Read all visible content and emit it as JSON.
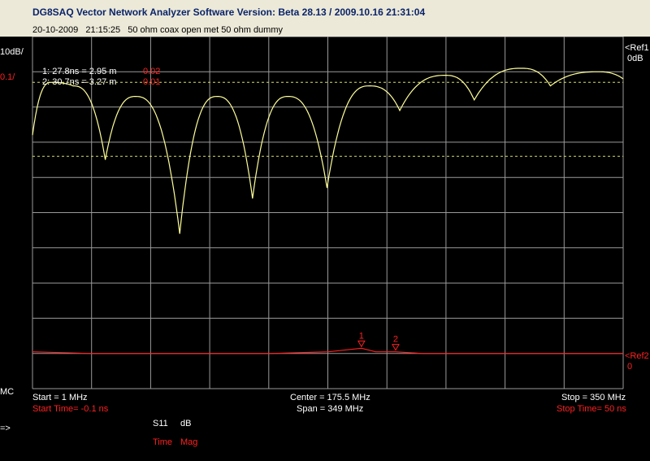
{
  "window": {
    "title": "DG8SAQ Vector Network Analyzer Software    Version:  Beta 28.13 / 2009.10.16 21:31:04"
  },
  "info": {
    "date": "20-10-2009",
    "time": "21:15:25",
    "description": "50 ohm coax open met 50 ohm dummy"
  },
  "scale": {
    "left_top": "10dB/",
    "left_second": "0.1/",
    "ref1_label": "<Ref1",
    "ref1_value": "0dB",
    "ref2_label": "<Ref2",
    "ref2_value": "0",
    "mc_label": "MC",
    "arrow_label": "=>"
  },
  "markers": {
    "line1": "1:   27.8ns = 2.95 m",
    "line1_value": "0.02",
    "line2": "2:   30.7ns = 3.27 m",
    "line2_value": "0.01",
    "m1_tag": "1",
    "m2_tag": "2"
  },
  "footer": {
    "start": "Start = 1 MHz",
    "start_time": "Start Time= -0.1 ns",
    "center": "Center = 175.5 MHz",
    "span": "Span = 349 MHz",
    "stop": "Stop = 350 MHz",
    "stop_time": "Stop Time= 50 ns",
    "s11": "S11",
    "db": "dB",
    "time": "Time",
    "mag": "Mag"
  },
  "colors": {
    "background": "#000000",
    "grid": "#9a9a9a",
    "trace1": "#ffff99",
    "limit_lines": "#d8e060",
    "trace2": "#ff2020",
    "label_white": "#ffffff",
    "label_red": "#ff2020"
  },
  "chart_data": [
    {
      "type": "line",
      "trace": "S11 dB (frequency)",
      "x_unit": "MHz",
      "x_range": [
        1,
        350
      ],
      "y_unit": "dB",
      "y_scale_per_div": 10,
      "ref": 0,
      "grid": true,
      "description_of_shape": "periodic ripple (standing wave) with deep nulls at about 44, 88, 131, 175 MHz, and shallower nulls with rising peaks toward 350 MHz",
      "x": [
        1,
        12,
        25,
        44,
        62,
        88,
        110,
        131,
        152,
        175,
        200,
        218,
        245,
        262,
        290,
        307,
        335,
        350
      ],
      "y": [
        -28,
        -13,
        -14,
        -35,
        -17,
        -56,
        -17,
        -46,
        -17,
        -43,
        -14,
        -21,
        -11,
        -18,
        -9,
        -14,
        -10,
        -12
      ],
      "limit_lines_dB": [
        -13,
        -34
      ]
    },
    {
      "type": "line",
      "trace": "S11 Mag (time)",
      "x_unit": "ns",
      "x_range": [
        -0.1,
        50
      ],
      "y_scale_per_div": 0.1,
      "ref": 0,
      "x": [
        -0.1,
        5,
        10,
        20,
        25,
        27.8,
        29,
        30.7,
        33,
        40,
        50
      ],
      "y": [
        0.01,
        0.005,
        0.005,
        0.005,
        0.01,
        0.02,
        0.01,
        0.01,
        0.005,
        0.005,
        0.005
      ],
      "markers": [
        {
          "name": "1",
          "time_ns": 27.8,
          "distance_m": 2.95,
          "value": 0.02
        },
        {
          "name": "2",
          "time_ns": 30.7,
          "distance_m": 3.27,
          "value": 0.01
        }
      ]
    }
  ]
}
